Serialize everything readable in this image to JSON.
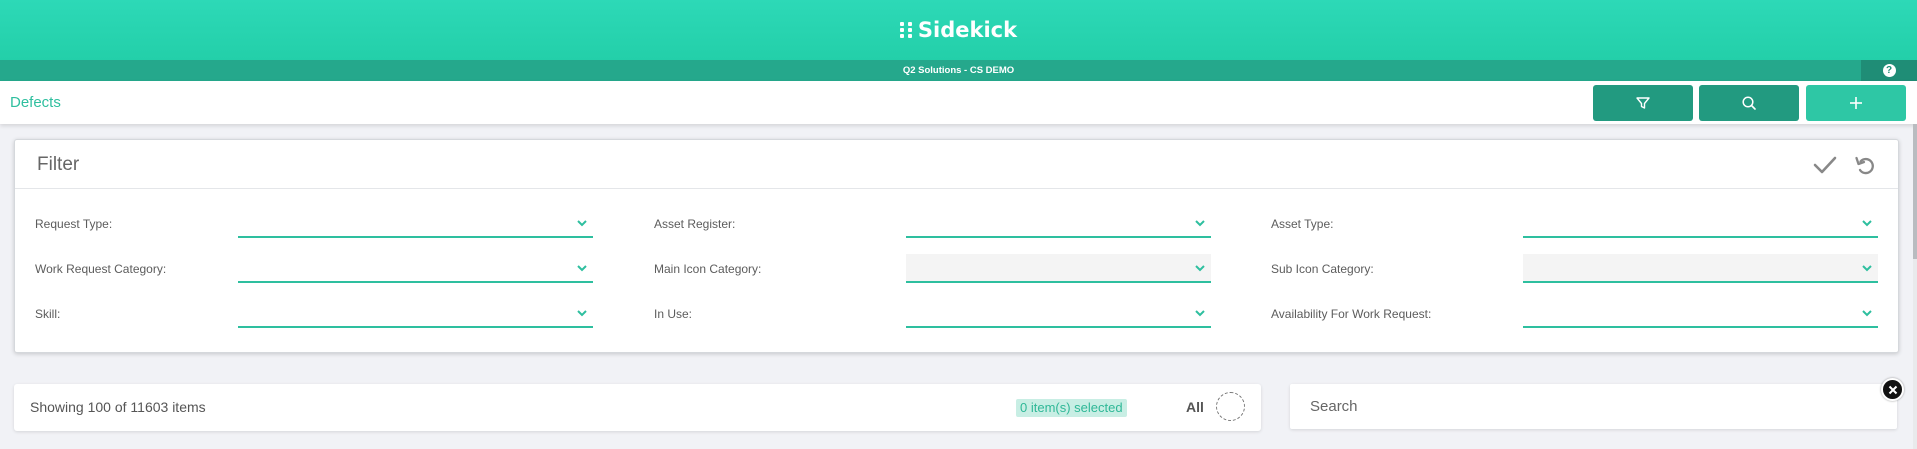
{
  "app": {
    "name": "Sidekick",
    "subtitle": "Q2 Solutions - CS DEMO",
    "help_symbol": "?"
  },
  "breadcrumb": "Defects",
  "toolbar": {
    "filter_icon": "filter-icon",
    "search_icon": "search-icon",
    "add_icon": "plus-icon"
  },
  "filter": {
    "title": "Filter",
    "apply_icon": "check-icon",
    "reset_icon": "undo-icon",
    "fields": [
      {
        "label": "Request Type:",
        "value": "",
        "disabled": false
      },
      {
        "label": "Asset Register:",
        "value": "",
        "disabled": false
      },
      {
        "label": "Asset Type:",
        "value": "",
        "disabled": false
      },
      {
        "label": "Work Request Category:",
        "value": "",
        "disabled": false
      },
      {
        "label": "Main Icon Category:",
        "value": "",
        "disabled": true
      },
      {
        "label": "Sub Icon Category:",
        "value": "",
        "disabled": true
      },
      {
        "label": "Skill:",
        "value": "",
        "disabled": false
      },
      {
        "label": "In Use:",
        "value": "",
        "disabled": false
      },
      {
        "label": "Availability For Work Request:",
        "value": "",
        "disabled": false
      }
    ]
  },
  "list": {
    "showing": "Showing 100 of 11603 items",
    "selected": "0 item(s) selected",
    "all_label": "All"
  },
  "search": {
    "placeholder": "Search",
    "value": ""
  },
  "colors": {
    "brand": "#2dd9b7",
    "brand_dark": "#229a80",
    "accent": "#2ebf9f"
  }
}
